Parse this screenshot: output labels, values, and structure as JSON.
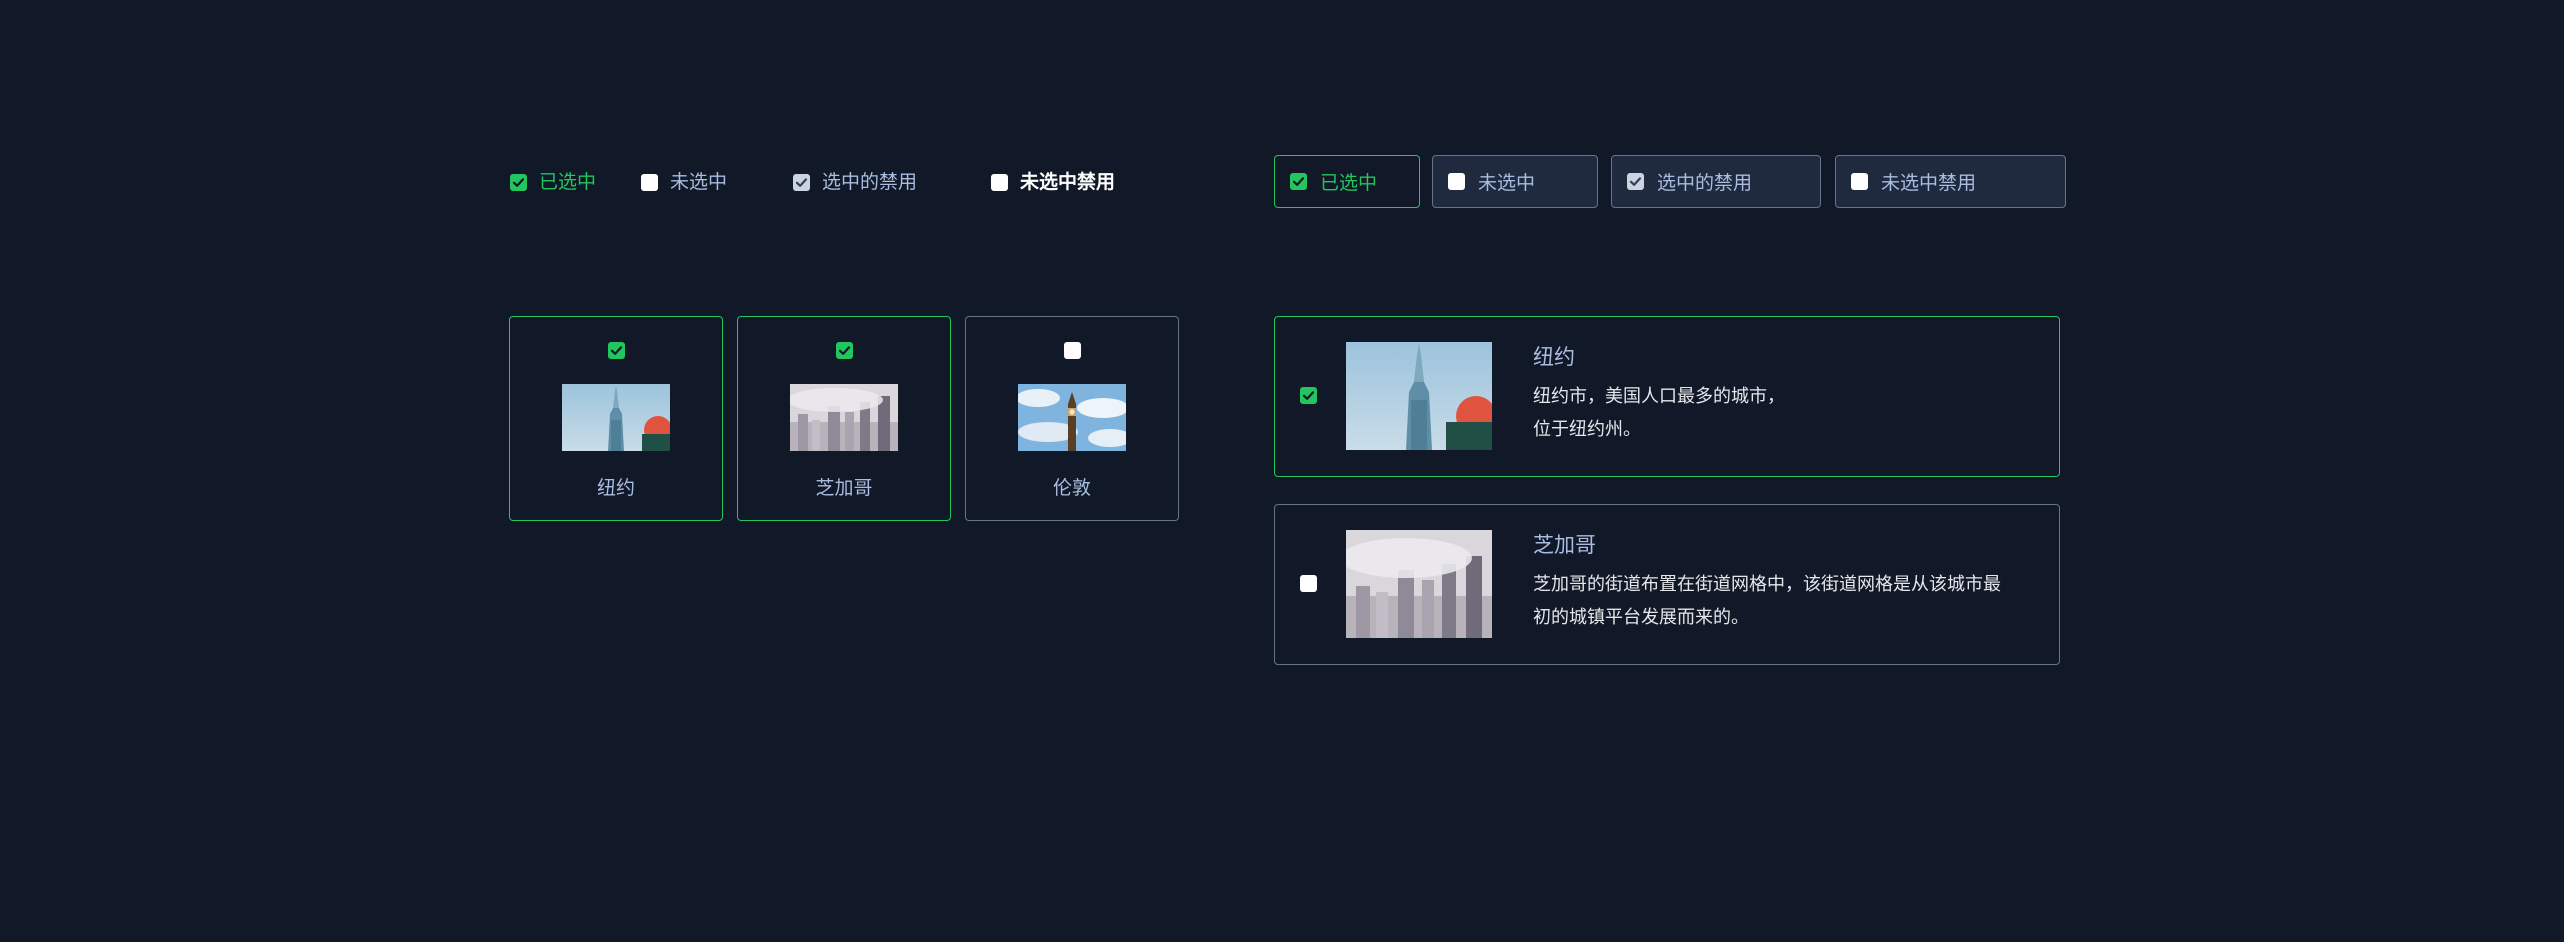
{
  "colors": {
    "background": "#111827",
    "accent": "#22c55e",
    "label": "#a9bde0",
    "border": "#64748b"
  },
  "plain_checkboxes": [
    {
      "label": "已选中",
      "checked": true,
      "disabled": false
    },
    {
      "label": "未选中",
      "checked": false,
      "disabled": false
    },
    {
      "label": "选中的禁用",
      "checked": true,
      "disabled": true
    },
    {
      "label": "未选中禁用",
      "checked": false,
      "disabled": true
    }
  ],
  "bordered_checkboxes": [
    {
      "label": "已选中",
      "checked": true,
      "disabled": false
    },
    {
      "label": "未选中",
      "checked": false,
      "disabled": false
    },
    {
      "label": "选中的禁用",
      "checked": true,
      "disabled": true
    },
    {
      "label": "未选中禁用",
      "checked": false,
      "disabled": true
    }
  ],
  "image_cards": [
    {
      "label": "纽约",
      "checked": true,
      "image": "empire-state-building"
    },
    {
      "label": "芝加哥",
      "checked": true,
      "image": "chicago-skyline-fog"
    },
    {
      "label": "伦敦",
      "checked": false,
      "image": "big-ben-clock-tower"
    }
  ],
  "list_cards": [
    {
      "title": "纽约",
      "desc_line1": "纽约市，美国人口最多的城市，",
      "desc_line2": "位于纽约州。",
      "checked": true,
      "image": "empire-state-building"
    },
    {
      "title": "芝加哥",
      "desc_line1": "芝加哥的街道布置在街道网格中，该街道网格是从该城市最",
      "desc_line2": "初的城镇平台发展而来的。",
      "checked": false,
      "image": "chicago-skyline-fog"
    }
  ]
}
